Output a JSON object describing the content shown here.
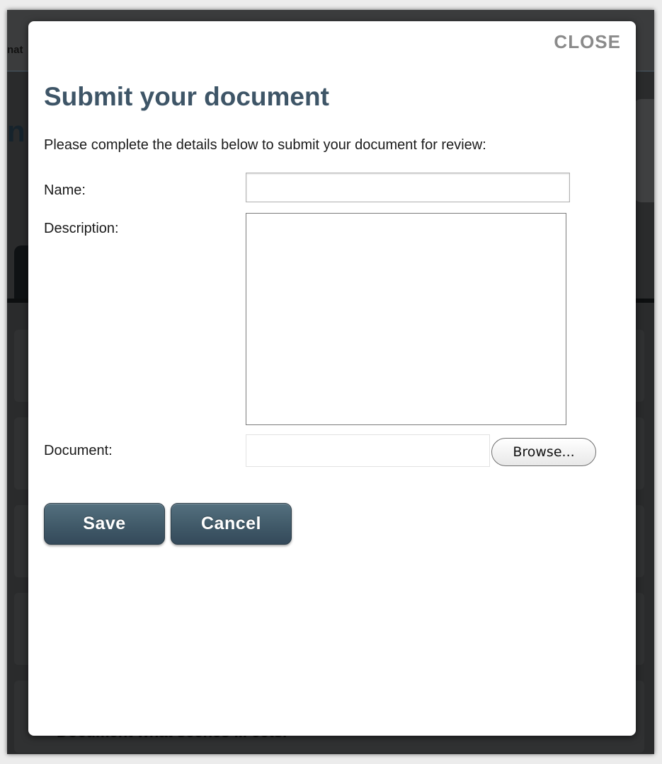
{
  "background": {
    "nav_fragment": "nat",
    "heading_fragment": "n",
    "footer_fragment": "Document what scenes ... ects."
  },
  "modal": {
    "close_label": "CLOSE",
    "title": "Submit your document",
    "intro": "Please complete the details below to submit your document for review:",
    "fields": {
      "name_label": "Name:",
      "name_value": "",
      "description_label": "Description:",
      "description_value": "",
      "document_label": "Document:",
      "browse_label": "Browse..."
    },
    "buttons": {
      "save_label": "Save",
      "cancel_label": "Cancel"
    }
  },
  "colors": {
    "title": "#3e5567",
    "button_top": "#54707f",
    "button_bottom": "#34495a",
    "close_link": "#8a8a8a",
    "overlay": "#2a2b2c"
  }
}
